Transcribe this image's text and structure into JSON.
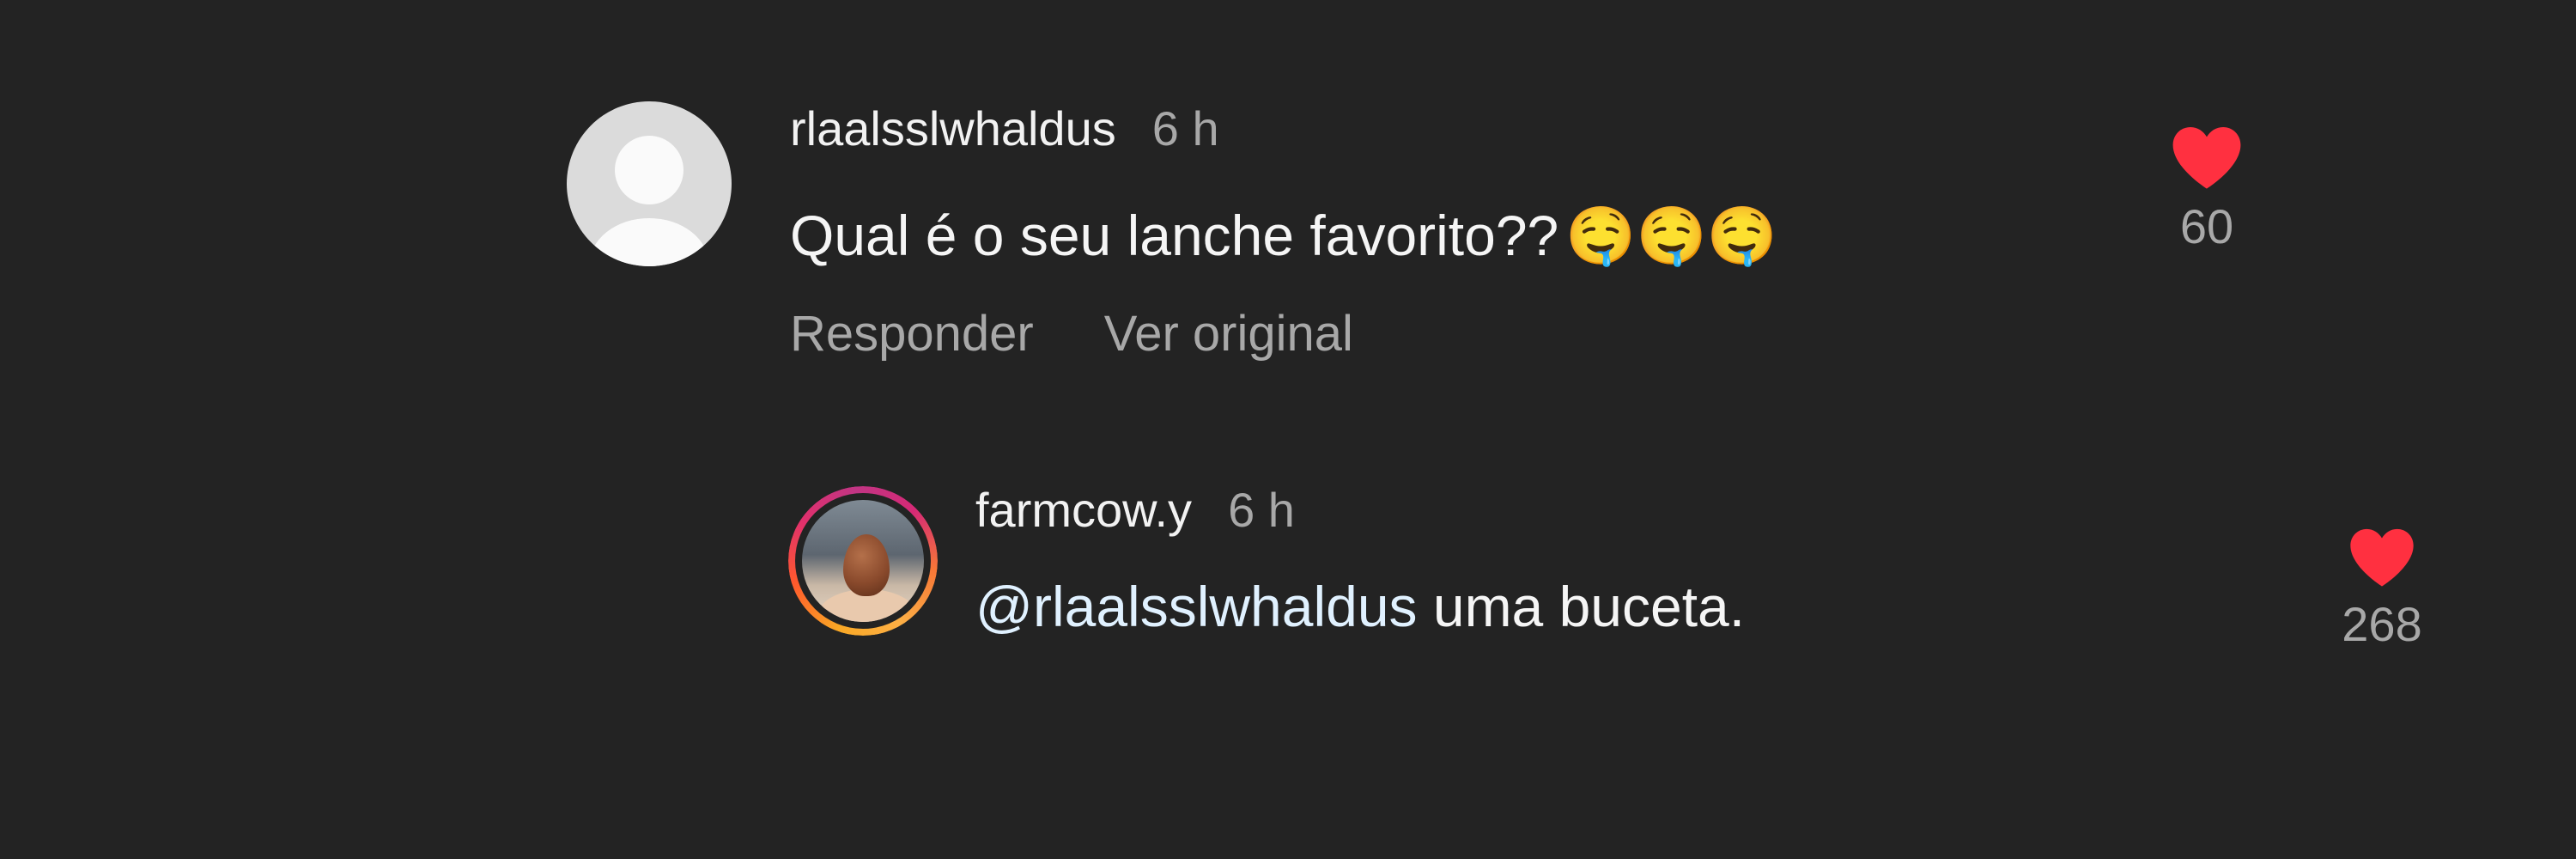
{
  "comments": [
    {
      "username": "rlaalsslwhaldus",
      "time": "6 h",
      "text": "Qual é o seu lanche favorito??",
      "emojis": "🤤🤤🤤",
      "actions": [
        "Responder",
        "Ver original"
      ],
      "likes": "60",
      "avatar_icon": "default-user-avatar"
    },
    {
      "username": "farmcow.y",
      "time": "6 h",
      "mention": "@rlaalsslwhaldus",
      "text": " uma buceta.",
      "likes": "268",
      "avatar_icon": "story-ring-avatar"
    }
  ],
  "colors": {
    "background": "#232323",
    "heart": "#ff3040",
    "muted": "#a8a8a8",
    "mention": "#e0f1ff"
  }
}
